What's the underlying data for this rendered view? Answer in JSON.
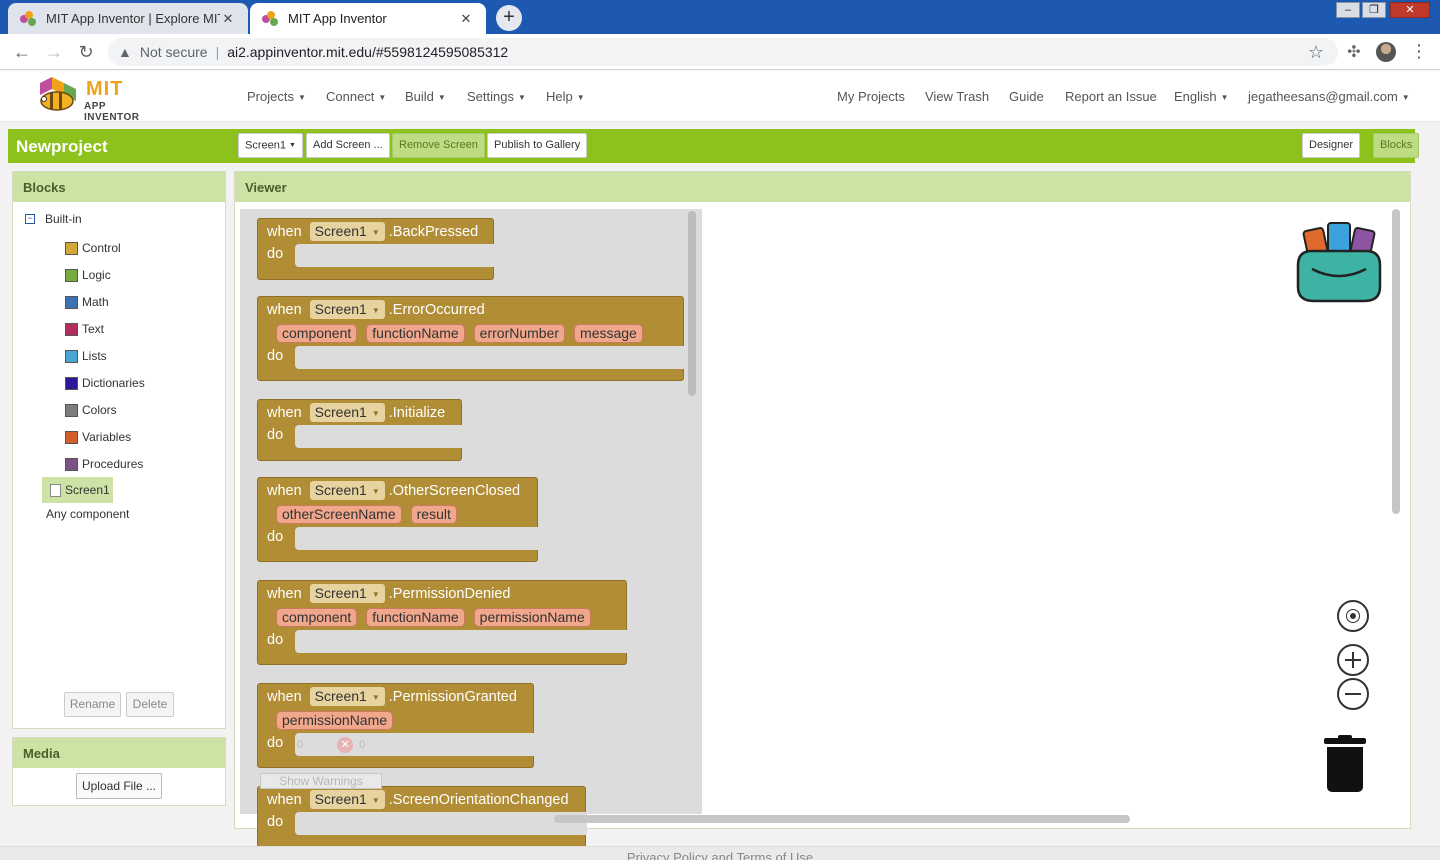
{
  "browser": {
    "tabs": [
      {
        "title": "MIT App Inventor | Explore MIT A",
        "active": false
      },
      {
        "title": "MIT App Inventor",
        "active": true
      }
    ],
    "security": "Not secure",
    "url": "ai2.appinventor.mit.edu/#5598124595085312"
  },
  "logo": {
    "mit": "MIT",
    "appinventor": "APP INVENTOR"
  },
  "nav": {
    "menus": [
      "Projects",
      "Connect",
      "Build",
      "Settings",
      "Help"
    ],
    "links": [
      "My Projects",
      "View Trash",
      "Guide",
      "Report an Issue"
    ],
    "language": "English",
    "account": "jegatheesans@gmail.com"
  },
  "project": {
    "name": "Newproject",
    "screen_select": "Screen1",
    "add_screen": "Add Screen ...",
    "remove_screen": "Remove Screen",
    "publish": "Publish to Gallery",
    "designer": "Designer",
    "blocks": "Blocks"
  },
  "blocks_panel": {
    "title": "Blocks",
    "builtin": "Built-in",
    "categories": [
      {
        "label": "Control",
        "color": "#d3a73a"
      },
      {
        "label": "Logic",
        "color": "#77ab41"
      },
      {
        "label": "Math",
        "color": "#3f72b5"
      },
      {
        "label": "Text",
        "color": "#b32d5e"
      },
      {
        "label": "Lists",
        "color": "#49a6d4"
      },
      {
        "label": "Dictionaries",
        "color": "#2d1799"
      },
      {
        "label": "Colors",
        "color": "#7d7d7d"
      },
      {
        "label": "Variables",
        "color": "#d05f2d"
      },
      {
        "label": "Procedures",
        "color": "#7c5385"
      }
    ],
    "screen_item": "Screen1",
    "any_component": "Any component",
    "rename": "Rename",
    "delete": "Delete"
  },
  "media_panel": {
    "title": "Media",
    "upload": "Upload File ..."
  },
  "viewer": {
    "title": "Viewer",
    "kw_when": "when",
    "kw_do": "do",
    "events": [
      {
        "component": "Screen1",
        "event": ".BackPressed",
        "params": []
      },
      {
        "component": "Screen1",
        "event": ".ErrorOccurred",
        "params": [
          "component",
          "functionName",
          "errorNumber",
          "message"
        ]
      },
      {
        "component": "Screen1",
        "event": ".Initialize",
        "params": []
      },
      {
        "component": "Screen1",
        "event": ".OtherScreenClosed",
        "params": [
          "otherScreenName",
          "result"
        ]
      },
      {
        "component": "Screen1",
        "event": ".PermissionDenied",
        "params": [
          "component",
          "functionName",
          "permissionName"
        ]
      },
      {
        "component": "Screen1",
        "event": ".PermissionGranted",
        "params": [
          "permissionName"
        ]
      },
      {
        "component": "Screen1",
        "event": ".ScreenOrientationChanged",
        "params": []
      }
    ],
    "warning_count": "0",
    "error_count": "0",
    "show_warnings": "Show Warnings"
  },
  "icons": {
    "backpack": "backpack-icon",
    "recenter": "crosshair-icon",
    "zoom_in": "zoom-in-icon",
    "zoom_out": "zoom-out-icon",
    "trash": "trash-icon"
  },
  "footer": {
    "text": "Privacy Policy and Terms of Use"
  }
}
